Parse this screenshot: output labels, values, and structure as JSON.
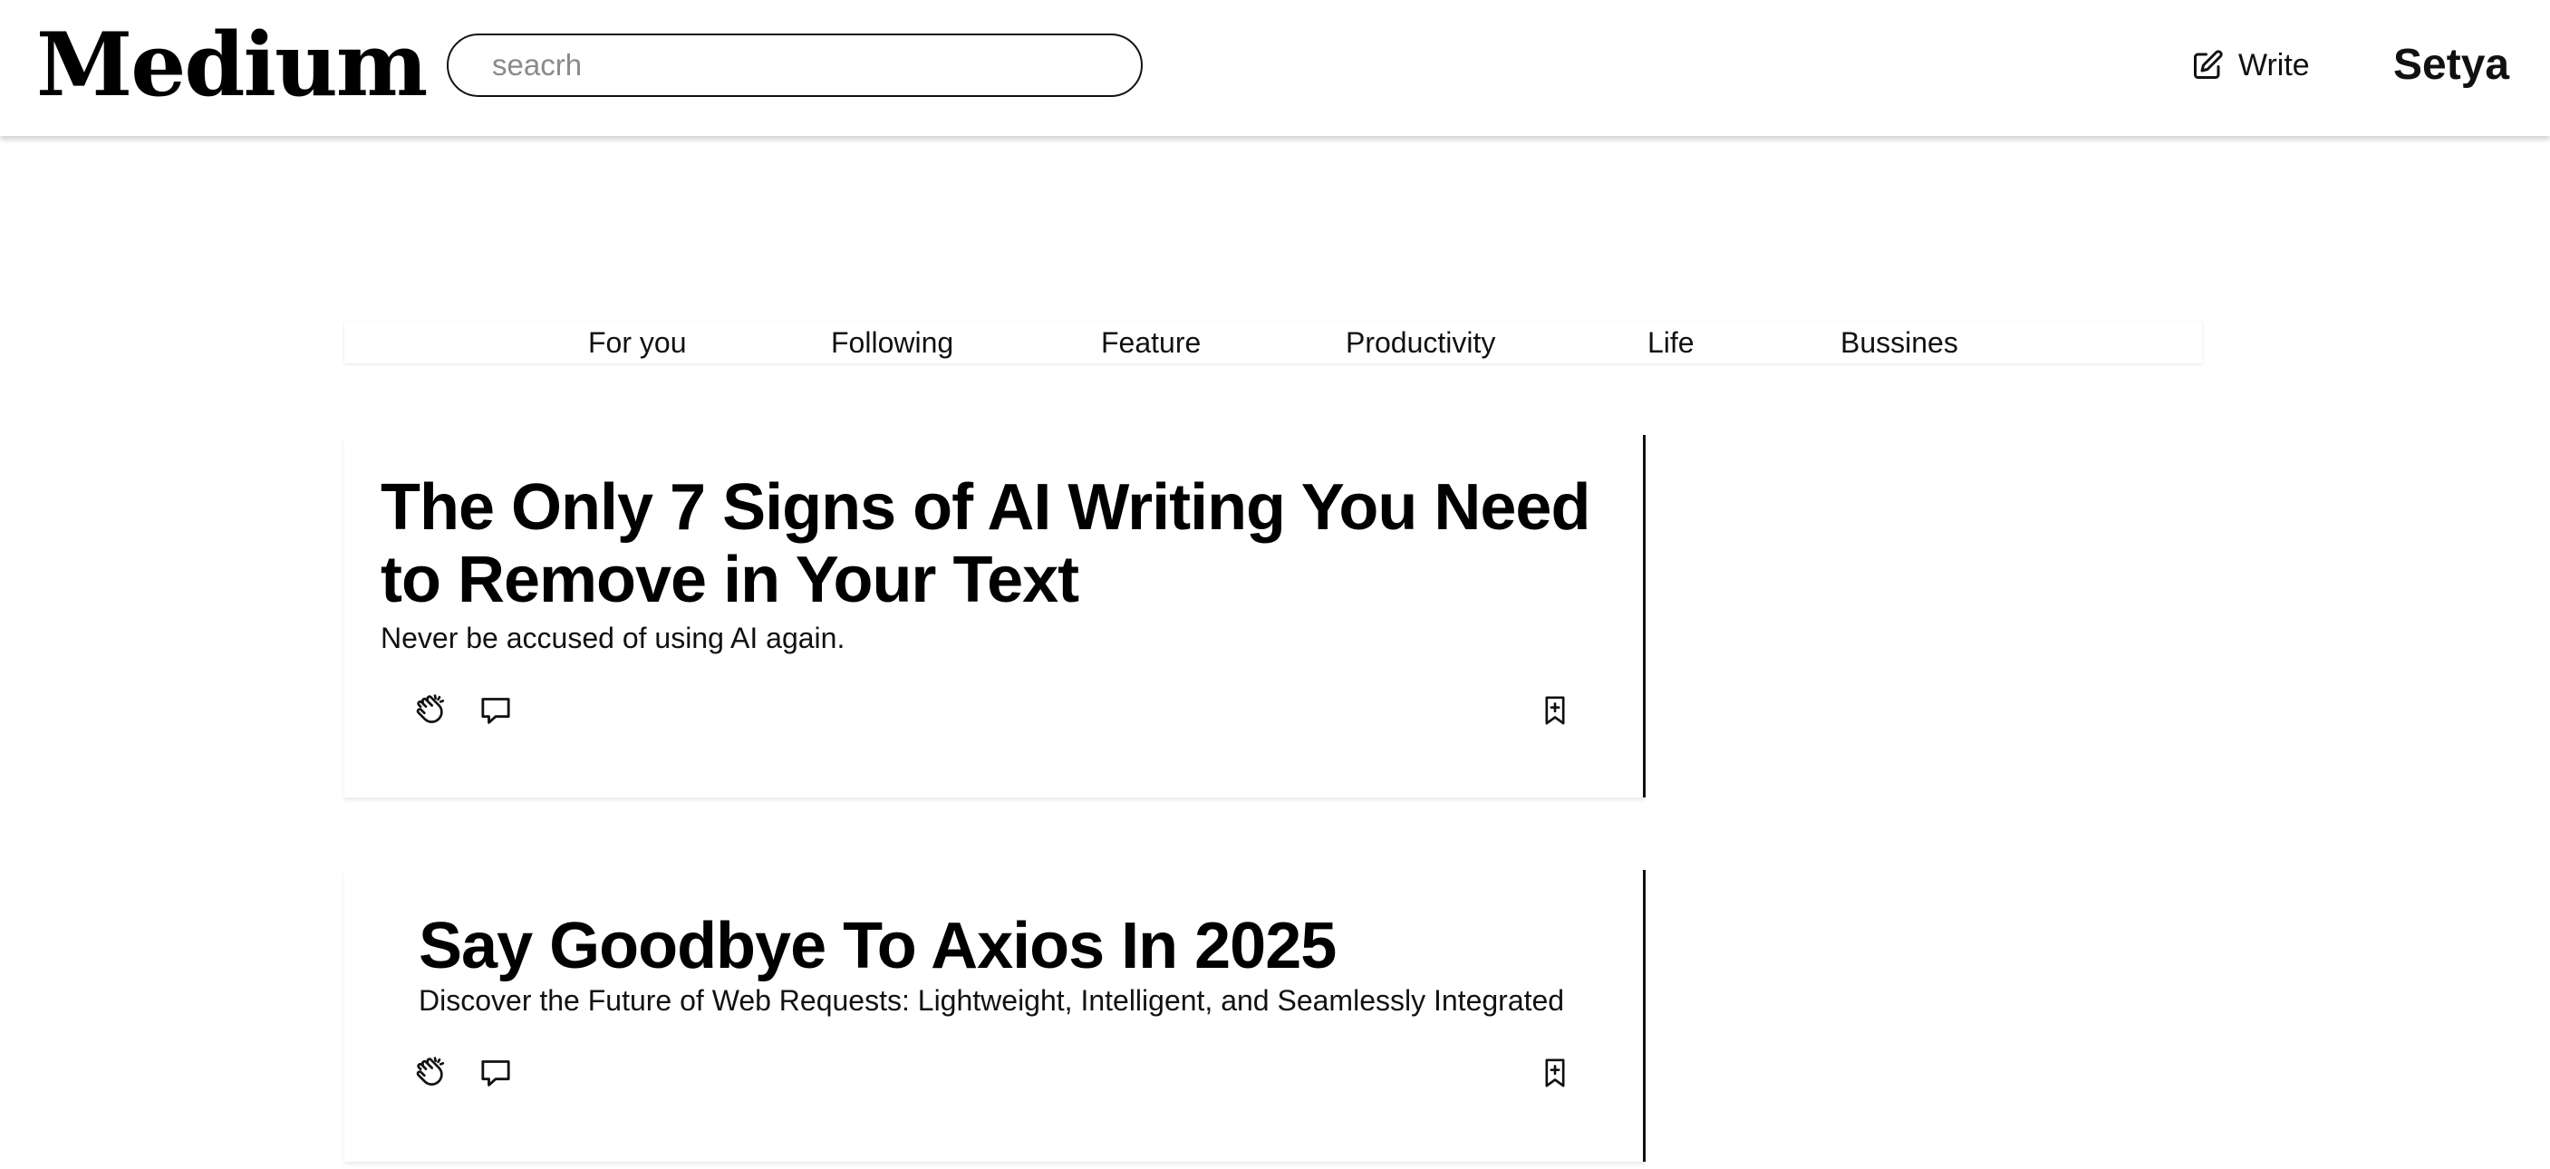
{
  "header": {
    "logo": "Medium",
    "search_placeholder": "seacrh",
    "write_label": "Write",
    "user_name": "Setya"
  },
  "tabs": [
    {
      "label": "For you"
    },
    {
      "label": "Following"
    },
    {
      "label": "Feature"
    },
    {
      "label": "Productivity"
    },
    {
      "label": "Life"
    },
    {
      "label": "Bussines"
    }
  ],
  "articles": [
    {
      "title": "The Only 7 Signs of AI Writing You Need to Remove in Your Text",
      "subtitle": "Never be accused of using AI again.",
      "icons": [
        "clap-icon",
        "comment-icon",
        "bookmark-icon"
      ]
    },
    {
      "title": "Say Goodbye To Axios In 2025",
      "subtitle": "Discover the Future of Web Requests: Lightweight, Intelligent, and Seamlessly Integrated",
      "icons": [
        "clap-icon",
        "comment-icon",
        "bookmark-icon"
      ]
    }
  ],
  "colors": {
    "text": "#111111",
    "background": "#ffffff",
    "placeholder": "#8a8a8a",
    "divider": "#111111"
  }
}
